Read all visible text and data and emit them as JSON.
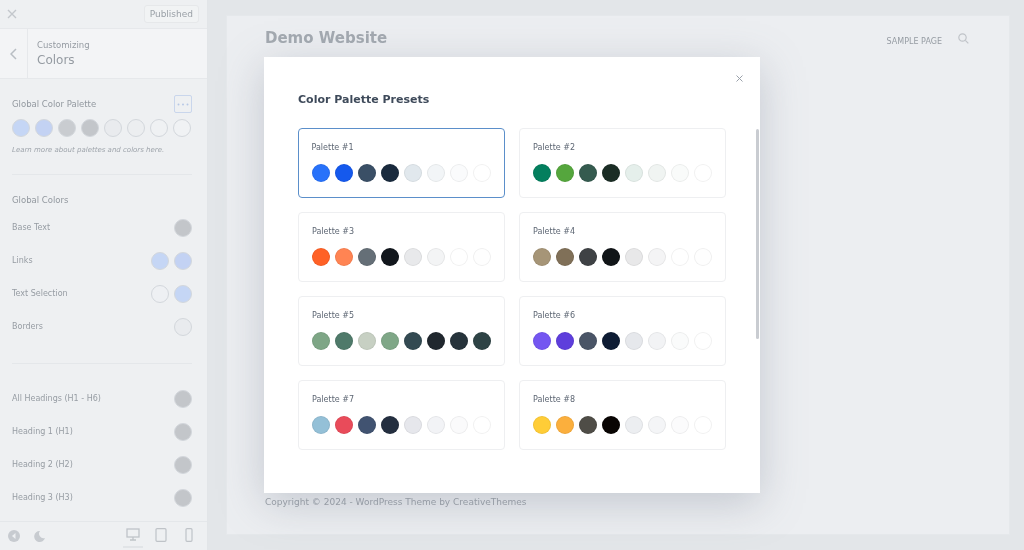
{
  "sidebar": {
    "publish_button": "Published",
    "breadcrumb": "Customizing",
    "title": "Colors",
    "palette": {
      "label": "Global Color Palette",
      "swatches": [
        {
          "color": "#c5d6f5"
        },
        {
          "color": "#c3d2f3"
        },
        {
          "color": "#c9ccd0"
        },
        {
          "color": "#c3c6ca"
        },
        {
          "color": "#e9ebee"
        },
        {
          "color": "#eceef0"
        },
        {
          "color": "#eff1f3"
        },
        {
          "color": "#f0f2f4"
        }
      ],
      "help": "Learn more about palettes and colors here."
    },
    "global_colors": {
      "heading": "Global Colors",
      "rows": [
        {
          "label": "Base Text",
          "swatches": [
            {
              "color": "#c3c6ca"
            }
          ]
        },
        {
          "label": "Links",
          "swatches": [
            {
              "color": "#c5d6f5"
            },
            {
              "color": "#c3d2f3"
            }
          ]
        },
        {
          "label": "Text Selection",
          "swatches": [
            {
              "color": "#eef0f3"
            },
            {
              "color": "#c5d6f5"
            }
          ]
        },
        {
          "label": "Borders",
          "swatches": [
            {
              "color": "#e9ebee"
            }
          ]
        }
      ]
    },
    "heading_colors": [
      {
        "label": "All Headings (H1 - H6)",
        "swatches": [
          {
            "color": "#c3c6ca"
          }
        ]
      },
      {
        "label": "Heading 1 (H1)",
        "swatches": [
          {
            "color": "#c3c6ca"
          }
        ]
      },
      {
        "label": "Heading 2 (H2)",
        "swatches": [
          {
            "color": "#c3c6ca"
          }
        ]
      },
      {
        "label": "Heading 3 (H3)",
        "swatches": [
          {
            "color": "#c3c6ca"
          }
        ]
      }
    ],
    "devices": [
      {
        "kind": "desktop",
        "selected": true
      },
      {
        "kind": "tablet",
        "selected": false
      },
      {
        "kind": "phone",
        "selected": false
      }
    ]
  },
  "preview": {
    "site_title": "Demo Website",
    "nav": [
      "SAMPLE PAGE"
    ],
    "footer": "Copyright © 2024 - WordPress Theme by CreativeThemes"
  },
  "modal": {
    "title": "Color Palette Presets",
    "palettes": [
      {
        "name": "Palette #1",
        "selected": true,
        "swatches": [
          {
            "color": "#2872fa"
          },
          {
            "color": "#1559ed"
          },
          {
            "color": "#3a4f66"
          },
          {
            "color": "#192a3d"
          },
          {
            "color": "#e1e8ed"
          },
          {
            "color": "#f2f5f7"
          },
          {
            "color": "#fafbfc"
          },
          {
            "color": "#ffffff"
          }
        ]
      },
      {
        "name": "Palette #2",
        "selected": false,
        "swatches": [
          {
            "color": "#037f5e"
          },
          {
            "color": "#55a63d"
          },
          {
            "color": "#355b4f"
          },
          {
            "color": "#1b2d25"
          },
          {
            "color": "#e5efeb"
          },
          {
            "color": "#f0f4f2"
          },
          {
            "color": "#f9fbfa"
          },
          {
            "color": "#ffffff"
          }
        ]
      },
      {
        "name": "Palette #3",
        "selected": false,
        "swatches": [
          {
            "color": "#ff6126"
          },
          {
            "color": "#ff8453"
          },
          {
            "color": "#656f77"
          },
          {
            "color": "#12171d"
          },
          {
            "color": "#e8e9eb"
          },
          {
            "color": "#f3f4f5"
          },
          {
            "color": "#ffffff"
          },
          {
            "color": "#fefefe"
          }
        ]
      },
      {
        "name": "Palette #4",
        "selected": false,
        "swatches": [
          {
            "color": "#a69577"
          },
          {
            "color": "#807058"
          },
          {
            "color": "#3f4245"
          },
          {
            "color": "#111518"
          },
          {
            "color": "#e8e8e9"
          },
          {
            "color": "#f4f4f5"
          },
          {
            "color": "#ffffff"
          },
          {
            "color": "#fefefe"
          }
        ]
      },
      {
        "name": "Palette #5",
        "selected": false,
        "swatches": [
          {
            "color": "#7ea686"
          },
          {
            "color": "#4f7a6a"
          },
          {
            "color": "#c7d0c3"
          },
          {
            "color": "#7fa787"
          },
          {
            "color": "#334a52"
          },
          {
            "color": "#20272e"
          },
          {
            "color": "#26333b"
          },
          {
            "color": "#2e4345"
          }
        ]
      },
      {
        "name": "Palette #6",
        "selected": false,
        "swatches": [
          {
            "color": "#7456f1"
          },
          {
            "color": "#5e3edc"
          },
          {
            "color": "#4a5567"
          },
          {
            "color": "#0e1c34"
          },
          {
            "color": "#e6e8ec"
          },
          {
            "color": "#f2f3f5"
          },
          {
            "color": "#fafbfb"
          },
          {
            "color": "#ffffff"
          }
        ]
      },
      {
        "name": "Palette #7",
        "selected": false,
        "swatches": [
          {
            "color": "#94c0d7"
          },
          {
            "color": "#e94b5a"
          },
          {
            "color": "#415371"
          },
          {
            "color": "#242f40"
          },
          {
            "color": "#e6e7ec"
          },
          {
            "color": "#f2f3f6"
          },
          {
            "color": "#fafafb"
          },
          {
            "color": "#ffffff"
          }
        ]
      },
      {
        "name": "Palette #8",
        "selected": false,
        "swatches": [
          {
            "color": "#ffcd37"
          },
          {
            "color": "#fbaf3d"
          },
          {
            "color": "#4f4d47"
          },
          {
            "color": "#090503"
          },
          {
            "color": "#eceef1"
          },
          {
            "color": "#f4f5f7"
          },
          {
            "color": "#fbfbfc"
          },
          {
            "color": "#ffffff"
          }
        ]
      }
    ]
  }
}
